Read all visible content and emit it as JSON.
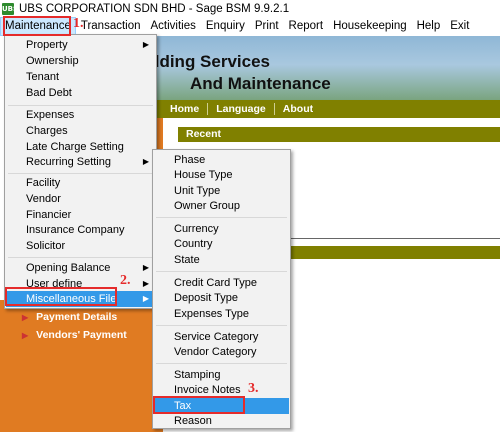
{
  "window": {
    "title": "UBS CORPORATION SDN BHD - Sage BSM 9.9.2.1",
    "icon": "ubs-app-icon",
    "icon_text": "UBS"
  },
  "menubar": [
    "Maintenance",
    "Transaction",
    "Activities",
    "Enquiry",
    "Print",
    "Report",
    "Housekeeping",
    "Help",
    "Exit"
  ],
  "banner": {
    "line1": "ilding Services",
    "line2": "And Maintenance"
  },
  "nav": [
    "Home",
    "Language",
    "About"
  ],
  "recent_label": "Recent",
  "left_panel": [
    "Payment Details",
    "Vendors' Payment"
  ],
  "maintenance_menu": [
    {
      "label": "Property",
      "submenu": true
    },
    {
      "label": "Ownership"
    },
    {
      "label": "Tenant"
    },
    {
      "label": "Bad Debt"
    },
    {
      "label": "Expenses"
    },
    {
      "label": "Charges"
    },
    {
      "label": "Late Charge Setting"
    },
    {
      "label": "Recurring Setting",
      "submenu": true
    },
    {
      "label": "Facility"
    },
    {
      "label": "Vendor"
    },
    {
      "label": "Financier"
    },
    {
      "label": "Insurance Company"
    },
    {
      "label": "Solicitor"
    },
    {
      "label": "Opening Balance",
      "submenu": true
    },
    {
      "label": "User define",
      "submenu": true
    },
    {
      "label": "Miscellaneous File",
      "submenu": true,
      "selected": true
    }
  ],
  "misc_menu": [
    {
      "label": "Phase"
    },
    {
      "label": "House Type"
    },
    {
      "label": "Unit Type"
    },
    {
      "label": "Owner Group"
    },
    {
      "label": "Currency"
    },
    {
      "label": "Country"
    },
    {
      "label": "State"
    },
    {
      "label": "Credit Card Type"
    },
    {
      "label": "Deposit Type"
    },
    {
      "label": "Expenses Type"
    },
    {
      "label": "Service Category"
    },
    {
      "label": "Vendor Category"
    },
    {
      "label": "Stamping"
    },
    {
      "label": "Invoice Notes"
    },
    {
      "label": "Tax",
      "selected": true
    },
    {
      "label": "Reason"
    }
  ],
  "annotations": [
    "1.",
    "2.",
    "3."
  ],
  "colors": {
    "highlight": "#3399e8",
    "annotation": "#e52b2b",
    "olive": "#808000",
    "orange": "#e07b22"
  }
}
